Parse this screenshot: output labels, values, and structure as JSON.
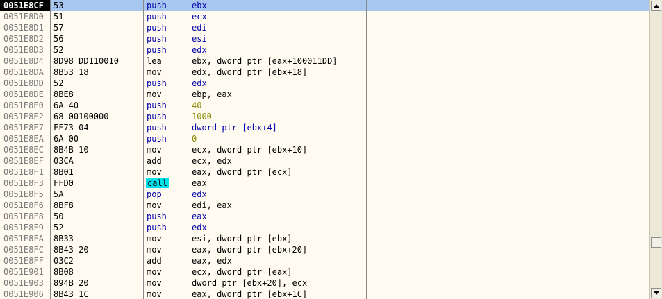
{
  "disassembly": {
    "selected_index": 0,
    "rows": [
      {
        "addr": "0051E8CF",
        "hex": "53",
        "mnemonic": "push",
        "operands": "ebx"
      },
      {
        "addr": "0051E8D0",
        "hex": "51",
        "mnemonic": "push",
        "operands": "ecx"
      },
      {
        "addr": "0051E8D1",
        "hex": "57",
        "mnemonic": "push",
        "operands": "edi"
      },
      {
        "addr": "0051E8D2",
        "hex": "56",
        "mnemonic": "push",
        "operands": "esi"
      },
      {
        "addr": "0051E8D3",
        "hex": "52",
        "mnemonic": "push",
        "operands": "edx"
      },
      {
        "addr": "0051E8D4",
        "hex": "8D98 DD110010",
        "mnemonic": "lea",
        "operands": "ebx, dword ptr [eax+100011DD]"
      },
      {
        "addr": "0051E8DA",
        "hex": "8B53 18",
        "mnemonic": "mov",
        "operands": "edx, dword ptr [ebx+18]"
      },
      {
        "addr": "0051E8DD",
        "hex": "52",
        "mnemonic": "push",
        "operands": "edx"
      },
      {
        "addr": "0051E8DE",
        "hex": "8BE8",
        "mnemonic": "mov",
        "operands": "ebp, eax"
      },
      {
        "addr": "0051E8E0",
        "hex": "6A 40",
        "mnemonic": "push",
        "operands": "40",
        "imm": true
      },
      {
        "addr": "0051E8E2",
        "hex": "68 00100000",
        "mnemonic": "push",
        "operands": "1000",
        "imm": true
      },
      {
        "addr": "0051E8E7",
        "hex": "FF73 04",
        "mnemonic": "push",
        "operands": "dword ptr [ebx+4]"
      },
      {
        "addr": "0051E8EA",
        "hex": "6A 00",
        "mnemonic": "push",
        "operands": "0",
        "imm": true
      },
      {
        "addr": "0051E8EC",
        "hex": "8B4B 10",
        "mnemonic": "mov",
        "operands": "ecx, dword ptr [ebx+10]"
      },
      {
        "addr": "0051E8EF",
        "hex": "03CA",
        "mnemonic": "add",
        "operands": "ecx, edx"
      },
      {
        "addr": "0051E8F1",
        "hex": "8B01",
        "mnemonic": "mov",
        "operands": "eax, dword ptr [ecx]"
      },
      {
        "addr": "0051E8F3",
        "hex": "FFD0",
        "mnemonic": "call",
        "operands": "eax"
      },
      {
        "addr": "0051E8F5",
        "hex": "5A",
        "mnemonic": "pop",
        "operands": "edx"
      },
      {
        "addr": "0051E8F6",
        "hex": "8BF8",
        "mnemonic": "mov",
        "operands": "edi, eax"
      },
      {
        "addr": "0051E8F8",
        "hex": "50",
        "mnemonic": "push",
        "operands": "eax"
      },
      {
        "addr": "0051E8F9",
        "hex": "52",
        "mnemonic": "push",
        "operands": "edx"
      },
      {
        "addr": "0051E8FA",
        "hex": "8B33",
        "mnemonic": "mov",
        "operands": "esi, dword ptr [ebx]"
      },
      {
        "addr": "0051E8FC",
        "hex": "8B43 20",
        "mnemonic": "mov",
        "operands": "eax, dword ptr [ebx+20]"
      },
      {
        "addr": "0051E8FF",
        "hex": "03C2",
        "mnemonic": "add",
        "operands": "eax, edx"
      },
      {
        "addr": "0051E901",
        "hex": "8B08",
        "mnemonic": "mov",
        "operands": "ecx, dword ptr [eax]"
      },
      {
        "addr": "0051E903",
        "hex": "894B 20",
        "mnemonic": "mov",
        "operands": "dword ptr [ebx+20], ecx"
      },
      {
        "addr": "0051E906",
        "hex": "8B43 1C",
        "mnemonic": "mov",
        "operands": "eax, dword ptr [ebx+1C]"
      }
    ]
  },
  "scrollbar": {
    "up_icon": "arrow-up-icon",
    "down_icon": "arrow-down-icon",
    "thumb_position": 0.84
  },
  "colors": {
    "background": "#fffbf0",
    "selection": "#a8c7f0",
    "address": "#7a7a7a",
    "push_pop": "#0000aa",
    "immediate": "#8a8a00",
    "call_highlight": "#00e0e8"
  }
}
